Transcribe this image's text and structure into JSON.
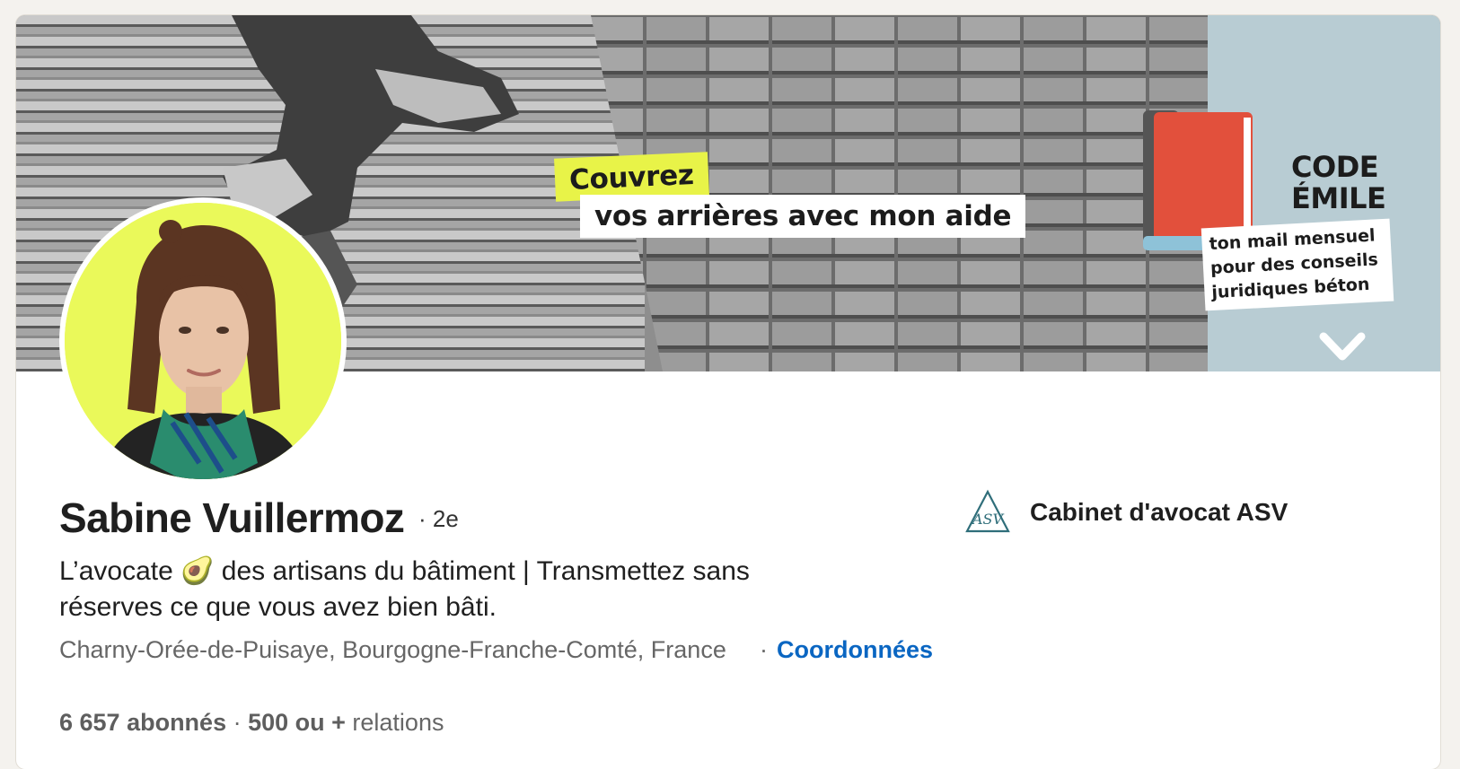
{
  "banner": {
    "tag_line1": "Couvrez",
    "tag_line2": "vos arrières avec mon aide",
    "newsletter_title_line1": "CODE",
    "newsletter_title_line2": "ÉMILE",
    "newsletter_subtitle_line1": "ton mail mensuel",
    "newsletter_subtitle_line2": "pour des conseils",
    "newsletter_subtitle_line3": "juridiques béton",
    "accent_yellow": "#e8f348",
    "side_color": "#b8ccd3",
    "book_color": "#e2503c"
  },
  "profile": {
    "name": "Sabine Vuillermoz",
    "degree": "· 2e",
    "headline_part1": "L’avocate ",
    "headline_emoji": "🥑",
    "headline_part2": " des artisans du bâtiment  |  Transmettez sans réserves ce que vous avez bien bâti.",
    "location": "Charny-Orée-de-Puisaye, Bourgogne-Franche-Comté, France",
    "contact_separator": "·",
    "contact_link": "Coordonnées",
    "followers": "6 657 abonnés",
    "stats_separator": " · ",
    "connections_count": "500 ou +",
    "connections_label": " relations",
    "avatar_bg": "#eaf95a"
  },
  "company": {
    "name": "Cabinet d'avocat ASV",
    "logo_text": "ASV",
    "logo_color": "#2f6e7a"
  },
  "colors": {
    "link": "#0a66c2",
    "page_bg": "#f4f2ee"
  }
}
